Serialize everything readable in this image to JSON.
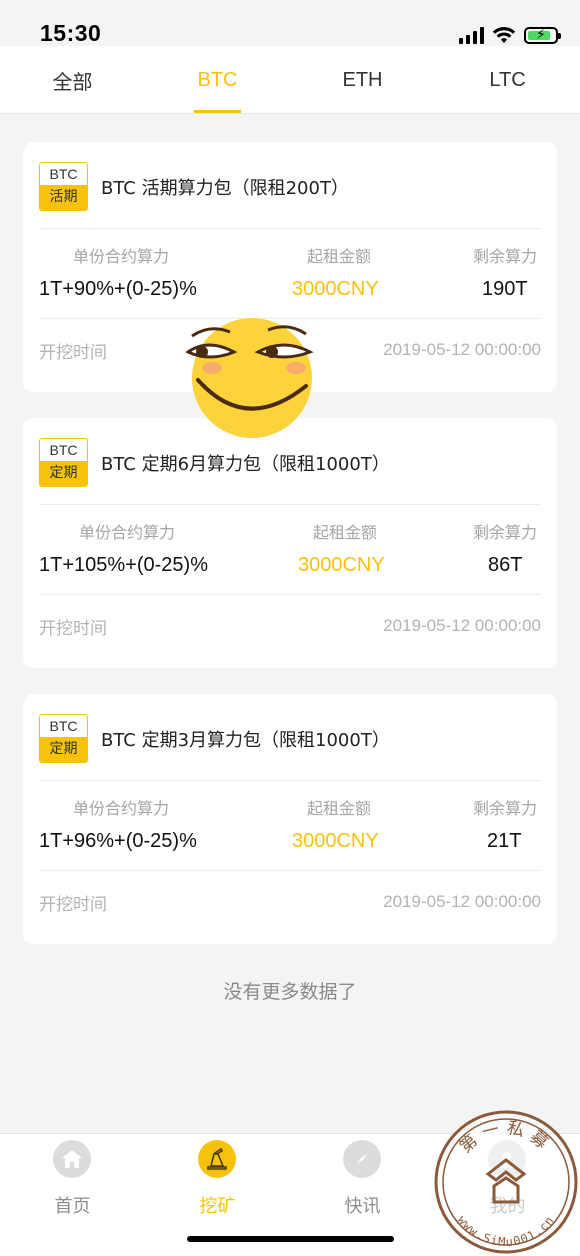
{
  "status_bar": {
    "time": "15:30"
  },
  "tabs": [
    {
      "label": "全部",
      "active": false
    },
    {
      "label": "BTC",
      "active": true
    },
    {
      "label": "ETH",
      "active": false
    },
    {
      "label": "LTC",
      "active": false
    }
  ],
  "labels": {
    "unit_power": "单份合约算力",
    "min_rent": "起租金额",
    "remaining": "剩余算力",
    "start_time": "开挖时间"
  },
  "cards": [
    {
      "badge_top": "BTC",
      "badge_bottom": "活期",
      "title": "BTC 活期算力包（限租200T）",
      "unit_power": "1T+90%+(0-25)%",
      "min_rent": "3000CNY",
      "remaining": "190T",
      "start_time": "2019-05-12 00:00:00"
    },
    {
      "badge_top": "BTC",
      "badge_bottom": "定期",
      "title": "BTC 定期6月算力包（限租1000T）",
      "unit_power": "1T+105%+(0-25)%",
      "min_rent": "3000CNY",
      "remaining": "86T",
      "start_time": "2019-05-12 00:00:00"
    },
    {
      "badge_top": "BTC",
      "badge_bottom": "定期",
      "title": "BTC 定期3月算力包（限租1000T）",
      "unit_power": "1T+96%+(0-25)%",
      "min_rent": "3000CNY",
      "remaining": "21T",
      "start_time": "2019-05-12 00:00:00"
    }
  ],
  "footer_text": "没有更多数据了",
  "bottom_nav": [
    {
      "label": "首页",
      "icon": "home-icon",
      "active": false
    },
    {
      "label": "挖矿",
      "icon": "mining-icon",
      "active": true
    },
    {
      "label": "快讯",
      "icon": "compass-icon",
      "active": false
    },
    {
      "label": "我的",
      "icon": "profile-icon",
      "active": false
    }
  ],
  "watermark": {
    "top": "第一私募",
    "bottom": "www.SiMu001.cn"
  },
  "colors": {
    "accent": "#f7c20b",
    "background": "#f4f4f4",
    "card": "#ffffff",
    "muted": "#b3b3b3"
  }
}
